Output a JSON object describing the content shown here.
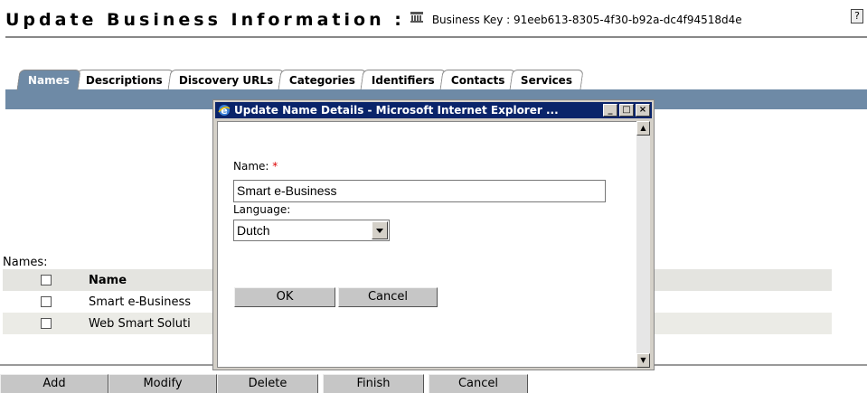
{
  "header": {
    "title": "Update Business Information :",
    "icon": "database-icon",
    "business_key": "Business Key : 91eeb613-8305-4f30-b92a-dc4f94518d4e",
    "help": "?"
  },
  "tabs": [
    {
      "label": "Names",
      "active": true
    },
    {
      "label": "Descriptions"
    },
    {
      "label": "Discovery URLs"
    },
    {
      "label": "Categories"
    },
    {
      "label": "Identifiers"
    },
    {
      "label": "Contacts"
    },
    {
      "label": "Services"
    }
  ],
  "names_section": {
    "label": "Names:",
    "header": "Name",
    "rows": [
      "Smart e-Business",
      "Web Smart Soluti"
    ]
  },
  "buttons": [
    "Add",
    "Modify",
    "Delete",
    "Finish",
    "Cancel"
  ],
  "dialog": {
    "title": "Update Name Details - Microsoft Internet Explorer ...",
    "name_label": "Name:",
    "required_mark": "*",
    "name_value": "Smart e-Business",
    "language_label": "Language:",
    "language_value": "Dutch",
    "ok": "OK",
    "cancel": "Cancel",
    "window_controls": {
      "minimize": "_",
      "maximize": "□",
      "close": "×"
    }
  },
  "colors": {
    "tab_bar": "#6e8aa6",
    "dialog_title_bg": "#0a246a",
    "required": "#dd0000"
  }
}
